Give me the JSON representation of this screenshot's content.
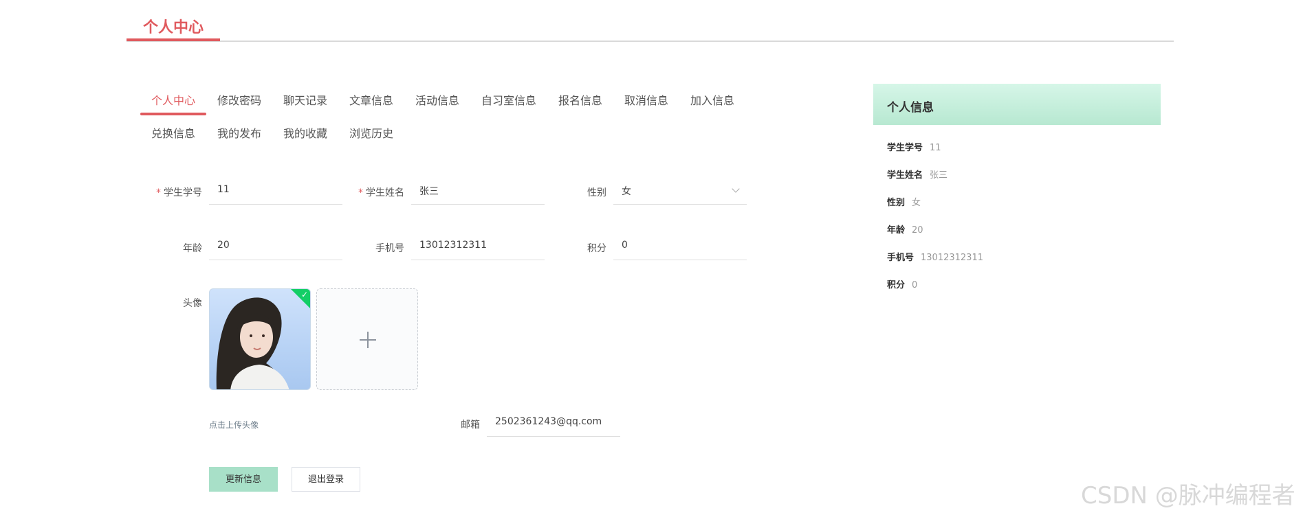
{
  "page": {
    "title": "个人中心"
  },
  "tabs": [
    {
      "label": "个人中心",
      "active": true
    },
    {
      "label": "修改密码"
    },
    {
      "label": "聊天记录"
    },
    {
      "label": "文章信息"
    },
    {
      "label": "活动信息"
    },
    {
      "label": "自习室信息"
    },
    {
      "label": "报名信息"
    },
    {
      "label": "取消信息"
    },
    {
      "label": "加入信息"
    },
    {
      "label": "兑换信息"
    },
    {
      "label": "我的发布"
    },
    {
      "label": "我的收藏"
    },
    {
      "label": "浏览历史"
    }
  ],
  "form": {
    "student_id": {
      "label": "学生学号",
      "value": "11",
      "required": true
    },
    "student_name": {
      "label": "学生姓名",
      "value": "张三",
      "required": true
    },
    "gender": {
      "label": "性别",
      "value": "女"
    },
    "age": {
      "label": "年龄",
      "value": "20"
    },
    "phone": {
      "label": "手机号",
      "value": "13012312311"
    },
    "points": {
      "label": "积分",
      "value": "0"
    },
    "avatar": {
      "label": "头像",
      "hint": "点击上传头像",
      "check_mark": "✓"
    },
    "email": {
      "label": "邮箱",
      "value": "2502361243@qq.com"
    },
    "required_mark": "*"
  },
  "buttons": {
    "update": "更新信息",
    "logout": "退出登录"
  },
  "info_panel": {
    "title": "个人信息",
    "rows": [
      {
        "key": "学生学号",
        "value": "11"
      },
      {
        "key": "学生姓名",
        "value": "张三"
      },
      {
        "key": "性别",
        "value": "女"
      },
      {
        "key": "年龄",
        "value": "20"
      },
      {
        "key": "手机号",
        "value": "13012312311"
      },
      {
        "key": "积分",
        "value": "0"
      }
    ]
  },
  "watermark": "CSDN @脉冲编程者",
  "colors": {
    "accent": "#e05a5e",
    "panel_header": "#c6efdc",
    "primary_button": "#a8e0c8",
    "success": "#13ce66"
  },
  "icons": {
    "chevron": "chevron-down-icon",
    "plus": "plus-icon",
    "check": "check-icon"
  }
}
